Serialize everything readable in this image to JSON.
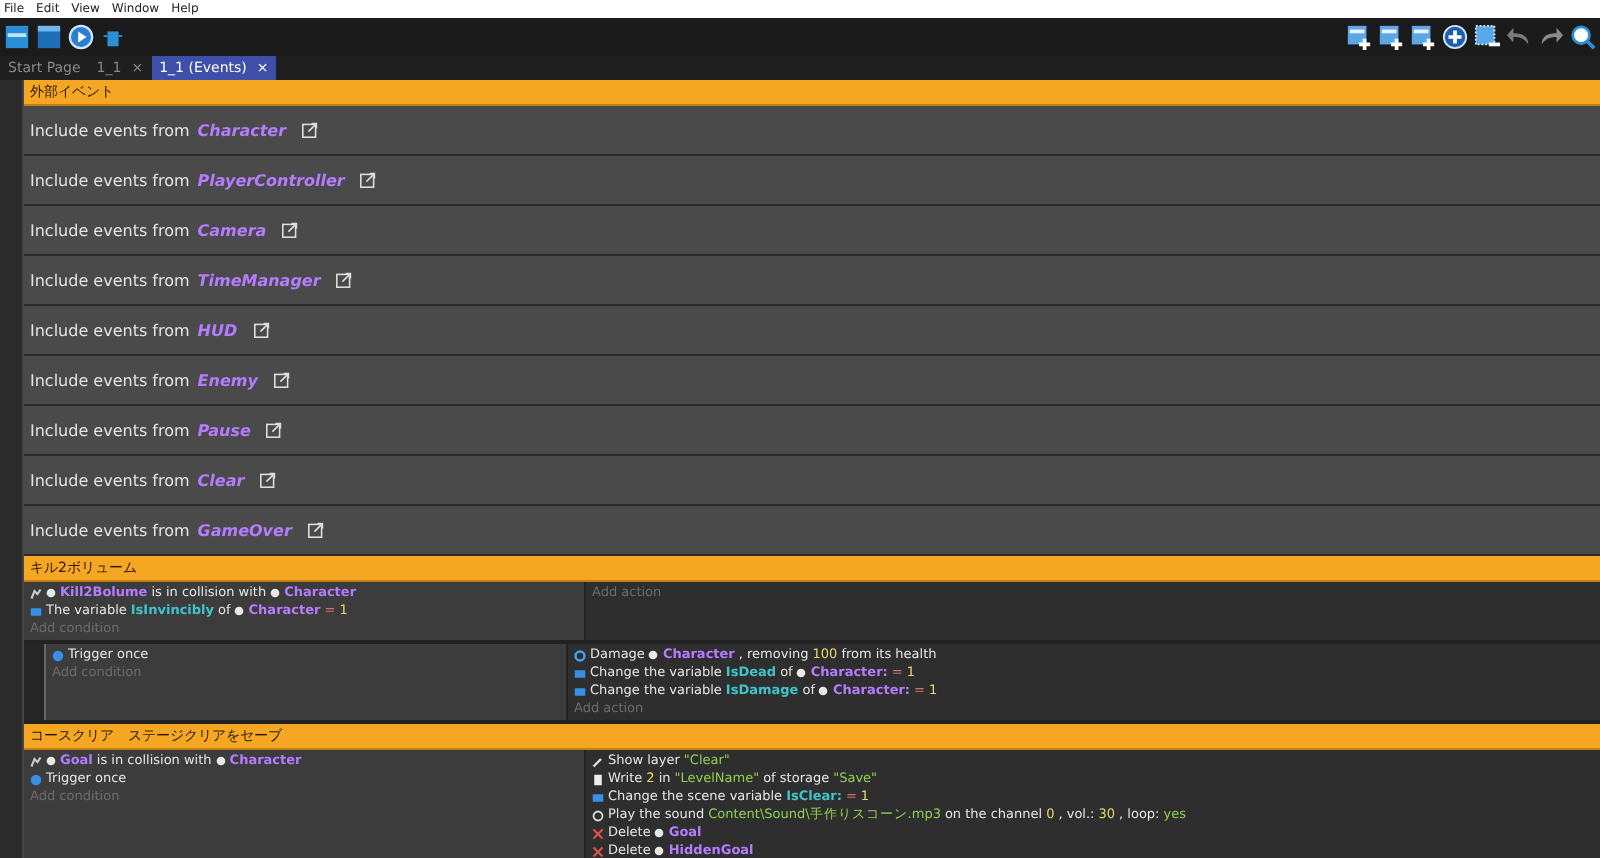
{
  "menu": [
    "File",
    "Edit",
    "View",
    "Window",
    "Help"
  ],
  "tabs": [
    {
      "label": "Start Page",
      "selected": false
    },
    {
      "label": "1_1",
      "close": "×",
      "selected": false
    },
    {
      "label": "1_1 (Events)",
      "close": "×",
      "selected": true
    }
  ],
  "groups": [
    {
      "title": "外部イベント",
      "includes": [
        {
          "text": "Include events from",
          "name": "Character"
        },
        {
          "text": "Include events from",
          "name": "PlayerController"
        },
        {
          "text": "Include events from",
          "name": "Camera"
        },
        {
          "text": "Include events from",
          "name": "TimeManager"
        },
        {
          "text": "Include events from",
          "name": "HUD"
        },
        {
          "text": "Include events from",
          "name": "Enemy"
        },
        {
          "text": "Include events from",
          "name": "Pause"
        },
        {
          "text": "Include events from",
          "name": "Clear"
        },
        {
          "text": "Include events from",
          "name": "GameOver"
        }
      ]
    },
    {
      "title": "キル2ボリューム",
      "events": [
        {
          "conditions": [
            {
              "kind": "collision",
              "parts": [
                {
                  "kind": "obj",
                  "text": "Kill2Bolume"
                },
                {
                  "kind": "text",
                  "text": "is in collision with"
                },
                {
                  "kind": "obj",
                  "text": "Character"
                }
              ]
            },
            {
              "kind": "variable",
              "parts": [
                {
                  "kind": "text",
                  "text": "The variable"
                },
                {
                  "kind": "var",
                  "text": "IsInvincibly"
                },
                {
                  "kind": "text",
                  "text": "of"
                },
                {
                  "kind": "obj",
                  "text": "Character"
                },
                {
                  "kind": "op",
                  "text": "="
                },
                {
                  "kind": "num",
                  "text": "1"
                }
              ]
            }
          ],
          "add_condition": "Add condition",
          "add_action": "Add action",
          "children": [
            {
              "conditions": [
                {
                  "kind": "trigger",
                  "parts": [
                    {
                      "kind": "text",
                      "text": "Trigger once"
                    }
                  ]
                }
              ],
              "add_condition": "Add condition",
              "actions": [
                {
                  "kind": "damage",
                  "parts": [
                    {
                      "kind": "text",
                      "text": "Damage"
                    },
                    {
                      "kind": "obj",
                      "text": "Character"
                    },
                    {
                      "kind": "text",
                      "text": ", removing"
                    },
                    {
                      "kind": "num",
                      "text": "100"
                    },
                    {
                      "kind": "text",
                      "text": "from its health"
                    }
                  ]
                },
                {
                  "kind": "variable",
                  "parts": [
                    {
                      "kind": "text",
                      "text": "Change the variable"
                    },
                    {
                      "kind": "var",
                      "text": "IsDead"
                    },
                    {
                      "kind": "text",
                      "text": "of"
                    },
                    {
                      "kind": "obj",
                      "text": "Character:"
                    },
                    {
                      "kind": "op",
                      "text": "="
                    },
                    {
                      "kind": "num",
                      "text": "1"
                    }
                  ]
                },
                {
                  "kind": "variable",
                  "parts": [
                    {
                      "kind": "text",
                      "text": "Change the variable"
                    },
                    {
                      "kind": "var",
                      "text": "IsDamage"
                    },
                    {
                      "kind": "text",
                      "text": "of"
                    },
                    {
                      "kind": "obj",
                      "text": "Character:"
                    },
                    {
                      "kind": "op",
                      "text": "="
                    },
                    {
                      "kind": "num",
                      "text": "1"
                    }
                  ]
                }
              ],
              "add_action": "Add action"
            }
          ]
        }
      ]
    },
    {
      "title": "コースクリア　ステージクリアをセーブ",
      "events": [
        {
          "conditions": [
            {
              "kind": "collision",
              "parts": [
                {
                  "kind": "obj",
                  "text": "Goal"
                },
                {
                  "kind": "text",
                  "text": "is in collision with"
                },
                {
                  "kind": "obj",
                  "text": "Character"
                }
              ]
            },
            {
              "kind": "trigger",
              "parts": [
                {
                  "kind": "text",
                  "text": "Trigger once"
                }
              ]
            }
          ],
          "add_condition": "Add condition",
          "actions": [
            {
              "kind": "layer",
              "parts": [
                {
                  "kind": "text",
                  "text": "Show layer"
                },
                {
                  "kind": "str",
                  "text": "\"Clear\""
                }
              ]
            },
            {
              "kind": "storage",
              "parts": [
                {
                  "kind": "text",
                  "text": "Write"
                },
                {
                  "kind": "num",
                  "text": "2"
                },
                {
                  "kind": "text",
                  "text": "in"
                },
                {
                  "kind": "str",
                  "text": "\"LevelName\""
                },
                {
                  "kind": "text",
                  "text": "of storage"
                },
                {
                  "kind": "str",
                  "text": "\"Save\""
                }
              ]
            },
            {
              "kind": "variable",
              "parts": [
                {
                  "kind": "text",
                  "text": "Change the scene variable"
                },
                {
                  "kind": "var",
                  "text": "IsClear:"
                },
                {
                  "kind": "op",
                  "text": "="
                },
                {
                  "kind": "num",
                  "text": "1"
                }
              ]
            },
            {
              "kind": "sound",
              "parts": [
                {
                  "kind": "text",
                  "text": "Play the sound"
                },
                {
                  "kind": "str",
                  "text": "Content\\Sound\\手作りスコーン.mp3"
                },
                {
                  "kind": "text",
                  "text": "on the channel"
                },
                {
                  "kind": "num",
                  "text": "0"
                },
                {
                  "kind": "text",
                  "text": ", vol.:"
                },
                {
                  "kind": "num",
                  "text": "30"
                },
                {
                  "kind": "text",
                  "text": ", loop:"
                },
                {
                  "kind": "str",
                  "text": "yes"
                }
              ]
            },
            {
              "kind": "delete",
              "parts": [
                {
                  "kind": "text",
                  "text": "Delete"
                },
                {
                  "kind": "obj",
                  "text": "Goal"
                }
              ]
            },
            {
              "kind": "delete",
              "parts": [
                {
                  "kind": "text",
                  "text": "Delete"
                },
                {
                  "kind": "obj",
                  "text": "HiddenGoal"
                }
              ]
            }
          ]
        }
      ]
    }
  ]
}
